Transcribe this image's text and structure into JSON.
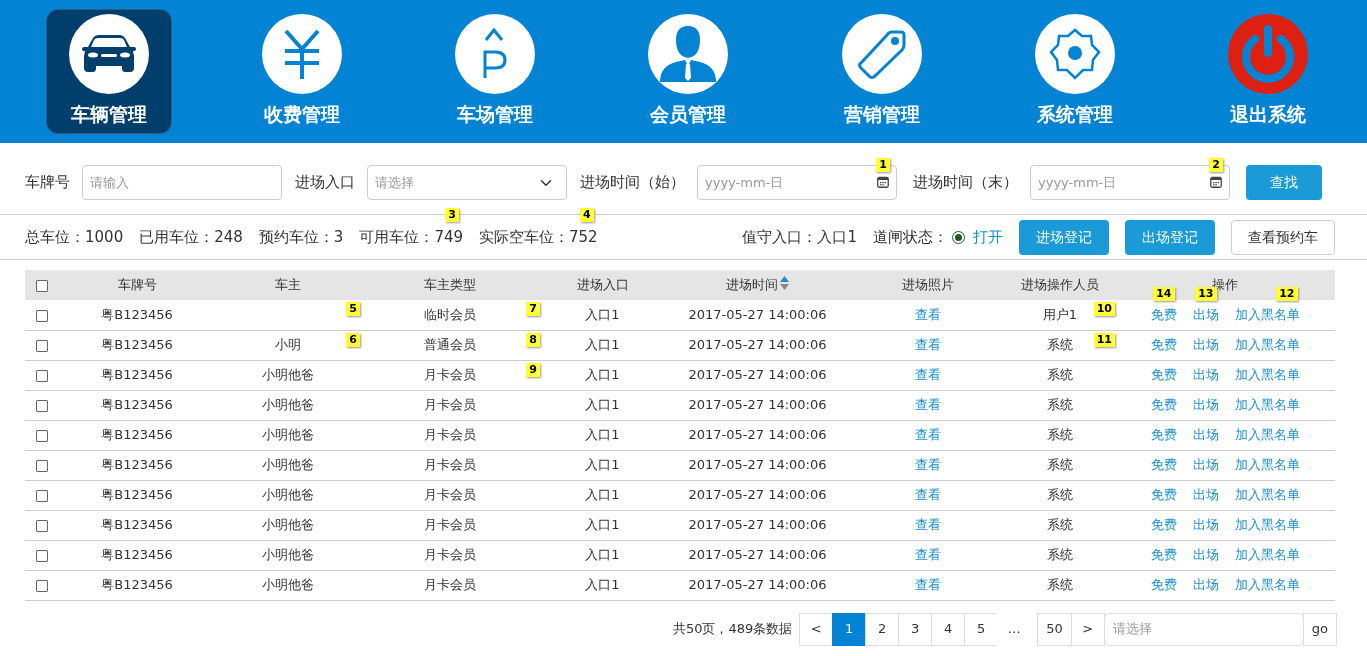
{
  "nav": [
    {
      "label": "车辆管理",
      "selected": true
    },
    {
      "label": "收费管理",
      "selected": false
    },
    {
      "label": "车场管理",
      "selected": false
    },
    {
      "label": "会员管理",
      "selected": false
    },
    {
      "label": "营销管理",
      "selected": false
    },
    {
      "label": "系统管理",
      "selected": false
    },
    {
      "label": "退出系统",
      "selected": false
    }
  ],
  "filters": [
    {
      "kind": "text",
      "label": "车牌号",
      "placeholder": "请输入"
    },
    {
      "kind": "select",
      "label": "进场入口",
      "placeholder": "请选择"
    },
    {
      "kind": "date",
      "label": "进场时间（始）",
      "placeholder": "yyyy-mm-日",
      "callout": "1"
    },
    {
      "kind": "date",
      "label": "进场时间（末）",
      "placeholder": "yyyy-mm-日",
      "callout": "2"
    }
  ],
  "search_button": "查找",
  "stats": [
    {
      "label": "总车位：",
      "value": "1000"
    },
    {
      "label": "已用车位：",
      "value": "248"
    },
    {
      "label": "预约车位：",
      "value": "3"
    },
    {
      "label": "可用车位：",
      "value": "749",
      "callout": "3"
    },
    {
      "label": "实际空车位：",
      "value": "752",
      "callout": "4"
    }
  ],
  "duty_entrance": {
    "label": "值守入口：",
    "value": "入口1"
  },
  "gate": {
    "label": "道闸状态：",
    "value": "打开",
    "checked": true
  },
  "action_buttons": [
    {
      "label": "进场登记",
      "kind": "primary"
    },
    {
      "label": "出场登记",
      "kind": "primary"
    },
    {
      "label": "查看预约车",
      "kind": "outline"
    }
  ],
  "table": {
    "select_all_checked": false,
    "columns": [
      {
        "label": "车牌号"
      },
      {
        "label": "车主"
      },
      {
        "label": "车主类型"
      },
      {
        "label": "进场入口"
      },
      {
        "label": "进场时间",
        "sorted_ascending": true
      },
      {
        "label": "进场照片"
      },
      {
        "label": "进场操作人员"
      },
      {
        "label": "操作"
      }
    ],
    "rows": [
      {
        "checked": false,
        "plate": "粤B123456",
        "owner_callout": "5",
        "type": "临时会员",
        "type_callout": "7",
        "entrance": "入口1",
        "time": "2017-05-27 14:00:06",
        "photo": "查看",
        "operator": "用户1",
        "operator_callout": "10",
        "actions": [
          {
            "label": "免费",
            "callout": "14"
          },
          {
            "label": "出场",
            "callout": "13"
          },
          {
            "label": "加入黑名单",
            "callout": "12"
          }
        ]
      },
      {
        "checked": false,
        "plate": "粤B123456",
        "owner": "小明",
        "owner_callout": "6",
        "type": "普通会员",
        "type_callout": "8",
        "entrance": "入口1",
        "time": "2017-05-27 14:00:06",
        "photo": "查看",
        "operator": "系统",
        "operator_callout": "11",
        "actions": [
          {
            "label": "免费"
          },
          {
            "label": "出场"
          },
          {
            "label": "加入黑名单"
          }
        ]
      },
      {
        "checked": false,
        "plate": "粤B123456",
        "owner": "小明他爸",
        "type": "月卡会员",
        "type_callout": "9",
        "entrance": "入口1",
        "time": "2017-05-27 14:00:06",
        "photo": "查看",
        "operator": "系统",
        "actions": [
          {
            "label": "免费"
          },
          {
            "label": "出场"
          },
          {
            "label": "加入黑名单"
          }
        ]
      },
      {
        "checked": false,
        "plate": "粤B123456",
        "owner": "小明他爸",
        "type": "月卡会员",
        "entrance": "入口1",
        "time": "2017-05-27 14:00:06",
        "photo": "查看",
        "operator": "系统",
        "actions": [
          {
            "label": "免费"
          },
          {
            "label": "出场"
          },
          {
            "label": "加入黑名单"
          }
        ]
      },
      {
        "checked": false,
        "plate": "粤B123456",
        "owner": "小明他爸",
        "type": "月卡会员",
        "entrance": "入口1",
        "time": "2017-05-27 14:00:06",
        "photo": "查看",
        "operator": "系统",
        "actions": [
          {
            "label": "免费"
          },
          {
            "label": "出场"
          },
          {
            "label": "加入黑名单"
          }
        ]
      },
      {
        "checked": false,
        "plate": "粤B123456",
        "owner": "小明他爸",
        "type": "月卡会员",
        "entrance": "入口1",
        "time": "2017-05-27 14:00:06",
        "photo": "查看",
        "operator": "系统",
        "actions": [
          {
            "label": "免费"
          },
          {
            "label": "出场"
          },
          {
            "label": "加入黑名单"
          }
        ]
      },
      {
        "checked": false,
        "plate": "粤B123456",
        "owner": "小明他爸",
        "type": "月卡会员",
        "entrance": "入口1",
        "time": "2017-05-27 14:00:06",
        "photo": "查看",
        "operator": "系统",
        "actions": [
          {
            "label": "免费"
          },
          {
            "label": "出场"
          },
          {
            "label": "加入黑名单"
          }
        ]
      },
      {
        "checked": false,
        "plate": "粤B123456",
        "owner": "小明他爸",
        "type": "月卡会员",
        "entrance": "入口1",
        "time": "2017-05-27 14:00:06",
        "photo": "查看",
        "operator": "系统",
        "actions": [
          {
            "label": "免费"
          },
          {
            "label": "出场"
          },
          {
            "label": "加入黑名单"
          }
        ]
      },
      {
        "checked": false,
        "plate": "粤B123456",
        "owner": "小明他爸",
        "type": "月卡会员",
        "entrance": "入口1",
        "time": "2017-05-27 14:00:06",
        "photo": "查看",
        "operator": "系统",
        "actions": [
          {
            "label": "免费"
          },
          {
            "label": "出场"
          },
          {
            "label": "加入黑名单"
          }
        ]
      },
      {
        "checked": false,
        "plate": "粤B123456",
        "owner": "小明他爸",
        "type": "月卡会员",
        "entrance": "入口1",
        "time": "2017-05-27 14:00:06",
        "photo": "查看",
        "operator": "系统",
        "actions": [
          {
            "label": "免费"
          },
          {
            "label": "出场"
          },
          {
            "label": "加入黑名单"
          }
        ]
      }
    ]
  },
  "pagination": {
    "summary": "共50页，489条数据",
    "pages": [
      {
        "label": "<",
        "kind": "prev",
        "selected": false
      },
      {
        "label": "1",
        "kind": "page",
        "selected": true
      },
      {
        "label": "2",
        "kind": "page",
        "selected": false
      },
      {
        "label": "3",
        "kind": "page",
        "selected": false
      },
      {
        "label": "4",
        "kind": "page",
        "selected": false
      },
      {
        "label": "5",
        "kind": "page",
        "selected": false
      },
      {
        "label": "…",
        "kind": "ellipsis",
        "selected": false
      },
      {
        "label": "50",
        "kind": "page",
        "selected": false
      },
      {
        "label": ">",
        "kind": "next",
        "selected": false
      }
    ],
    "jump_placeholder": "请选择",
    "go": "go"
  }
}
